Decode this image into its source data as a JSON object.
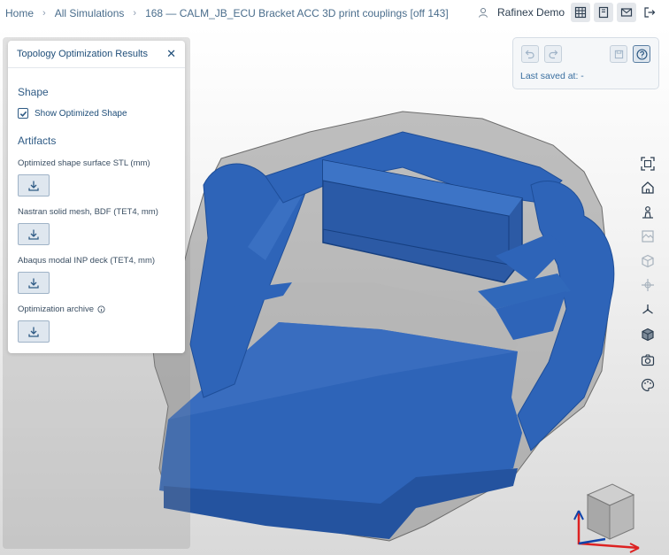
{
  "breadcrumb": {
    "home": "Home",
    "all_simulations": "All Simulations",
    "current": "168 — CALM_JB_ECU Bracket ACC 3D print couplings [off 143]"
  },
  "user": {
    "name": "Rafinex Demo"
  },
  "panel": {
    "title": "Topology Optimization Results",
    "close": "✕",
    "shape_section": "Shape",
    "show_optimized_label": "Show Optimized Shape",
    "show_optimized_checked": true,
    "artifacts_section": "Artifacts",
    "artifacts": [
      {
        "label": "Optimized shape surface STL (mm)"
      },
      {
        "label": "Nastran solid mesh, BDF (TET4, mm)"
      },
      {
        "label": "Abaqus modal INP deck (TET4, mm)"
      },
      {
        "label": "Optimization archive"
      }
    ]
  },
  "save_box": {
    "last_saved": "Last saved at: -"
  },
  "colors": {
    "model_blue": "#2e64b8",
    "ghost_gray": "#8c8c8c",
    "accent": "#1f4e79"
  },
  "right_tools": [
    "fit-view-icon",
    "home-icon",
    "person-icon",
    "texture-icon",
    "cube-icon",
    "grid-icon",
    "axes-icon",
    "box-icon",
    "camera-icon",
    "palette-icon"
  ]
}
